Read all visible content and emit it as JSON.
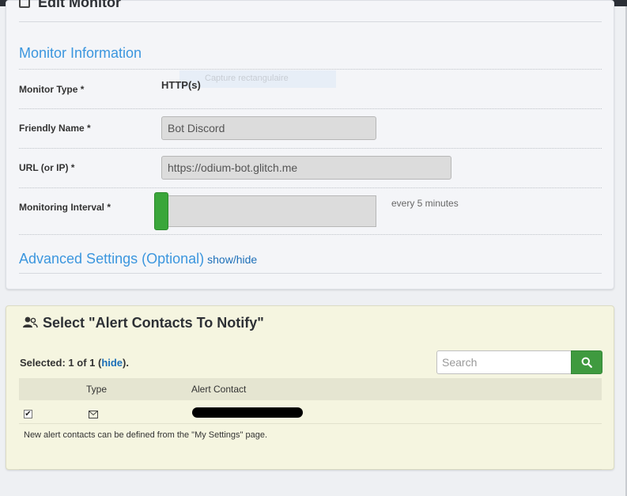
{
  "edit_monitor": {
    "title": "Edit Monitor",
    "section_title": "Monitor Information",
    "monitor_type": {
      "label": "Monitor Type *",
      "value": "HTTP(s)"
    },
    "capture_overlay": "Capture rectangulaire",
    "friendly_name": {
      "label": "Friendly Name *",
      "value": "Bot Discord"
    },
    "url": {
      "label": "URL (or IP) *",
      "value": "https://odium-bot.glitch.me"
    },
    "interval": {
      "label": "Monitoring Interval *",
      "text": "every 5 minutes",
      "slider_position": 0.0
    },
    "advanced": {
      "title": "Advanced Settings (Optional)",
      "toggle": "show/hide"
    }
  },
  "alert_contacts": {
    "title": "Select \"Alert Contacts To Notify\"",
    "selected_prefix": "Selected: 1 of 1 (",
    "selected_link": "hide",
    "selected_suffix": ").",
    "search_placeholder": "Search",
    "columns": [
      "Type",
      "Alert Contact"
    ],
    "rows": [
      {
        "checked": true,
        "type_icon": "envelope-icon"
      }
    ],
    "note": "New alert contacts can be defined from the \"My Settings\" page."
  },
  "colors": {
    "link_blue": "#3b96de",
    "accent_green": "#3f9a3f",
    "contacts_panel_bg": "#f5f5e0"
  }
}
